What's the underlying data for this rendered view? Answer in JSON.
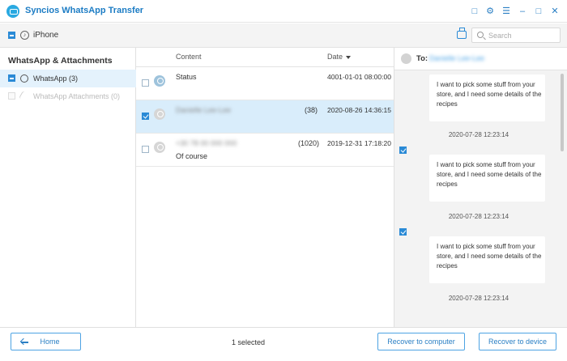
{
  "app": {
    "title": "Syncios WhatsApp Transfer"
  },
  "device": {
    "name": "iPhone"
  },
  "sidebar": {
    "section_title": "WhatsApp & Attachments",
    "items": [
      {
        "label": "WhatsApp (3)"
      },
      {
        "label": "WhatsApp Attachments (0)"
      }
    ]
  },
  "search": {
    "placeholder": "Search"
  },
  "list": {
    "columns": {
      "content": "Content",
      "date": "Date"
    },
    "rows": [
      {
        "name": "Status",
        "count": "",
        "date": "4001-01-01 08:00:00",
        "preview": "",
        "checked": false,
        "selected": false
      },
      {
        "name": "Danielle Lee-Lee",
        "count": "(38)",
        "date": "2020-08-26 14:36:15",
        "preview": "",
        "checked": true,
        "selected": true
      },
      {
        "name": "+30 78 00 000 000",
        "count": "(1020)",
        "date": "2019-12-31 17:18:20",
        "preview": "Of course",
        "checked": false,
        "selected": false
      }
    ]
  },
  "chat": {
    "to_label": "To:",
    "to_name": "Danielle Lee-Lee",
    "messages": [
      {
        "text": "I want to pick some stuff from your store, and I need some details of the recipes",
        "time": "2020-07-28 12:23:14"
      },
      {
        "text": "I want to pick some stuff from your store, and I need some details of the recipes",
        "time": "2020-07-28 12:23:14"
      },
      {
        "text": "I want to pick some stuff from your store, and I need some details of the recipes",
        "time": "2020-07-28 12:23:14"
      }
    ]
  },
  "footer": {
    "home_label": "Home",
    "status": "1 selected",
    "recover_computer_label": "Recover to computer",
    "recover_device_label": "Recover to device"
  }
}
